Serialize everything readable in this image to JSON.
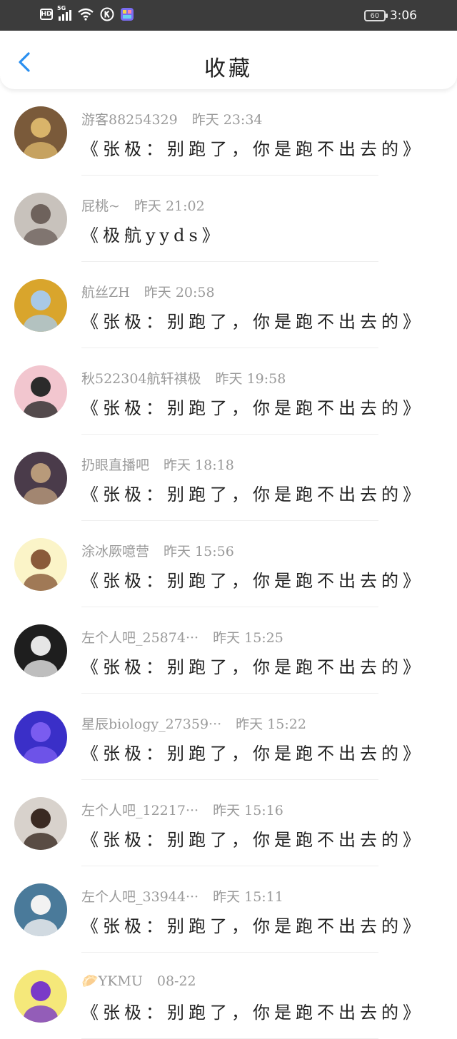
{
  "status_bar": {
    "hd": "HD",
    "network": "5G",
    "battery": "60",
    "time": "3:06"
  },
  "header": {
    "title": "收藏",
    "back_icon": "chevron-left-icon"
  },
  "colors": {
    "accent": "#2a8ff0",
    "status_bar_bg": "#3c3c3c",
    "meta_text": "#9a9a9a"
  },
  "items": [
    {
      "user": "游客88254329",
      "time": "昨天 23:34",
      "text": "《张极：别跑了，你是跑不出去的》",
      "avatar_color": "#7a5a3a",
      "avatar_accent": "#d9b46a"
    },
    {
      "user": "屁桃~",
      "time": "昨天 21:02",
      "text": "《极航yyds》",
      "avatar_color": "#c8c2bc",
      "avatar_accent": "#6e625c"
    },
    {
      "user": "航丝ZH",
      "time": "昨天 20:58",
      "text": "《张极：别跑了，你是跑不出去的》",
      "avatar_color": "#d9a52c",
      "avatar_accent": "#a9c9e6"
    },
    {
      "user": "秋522304航轩祺极",
      "time": "昨天 19:58",
      "text": "《张极：别跑了，你是跑不出去的》",
      "avatar_color": "#f2c6cf",
      "avatar_accent": "#2b2b2b"
    },
    {
      "user": "扔眼直播吧",
      "time": "昨天 18:18",
      "text": "《张极：别跑了，你是跑不出去的》",
      "avatar_color": "#4a3b4a",
      "avatar_accent": "#b89a7a"
    },
    {
      "user": "涂冰厥噫营",
      "time": "昨天 15:56",
      "text": "《张极：别跑了，你是跑不出去的》",
      "avatar_color": "#fbf4c8",
      "avatar_accent": "#8a5a3a"
    },
    {
      "user": "左个人吧_25874···",
      "time": "昨天 15:25",
      "text": "《张极：别跑了，你是跑不出去的》",
      "avatar_color": "#1e1e1e",
      "avatar_accent": "#e6e6e6"
    },
    {
      "user": "星辰biology_27359···",
      "time": "昨天 15:22",
      "text": "《张极：别跑了，你是跑不出去的》",
      "avatar_color": "#3a2fc8",
      "avatar_accent": "#7a5cf0"
    },
    {
      "user": "左个人吧_12217···",
      "time": "昨天 15:16",
      "text": "《张极：别跑了，你是跑不出去的》",
      "avatar_color": "#d8d2cc",
      "avatar_accent": "#3a2a22"
    },
    {
      "user": "左个人吧_33944···",
      "time": "昨天 15:11",
      "text": "《张极：别跑了，你是跑不出去的》",
      "avatar_color": "#4a7a9a",
      "avatar_accent": "#f2f2f2"
    },
    {
      "user": "🥟YKMU",
      "time": "08-22",
      "text": "《张极：别跑了，你是跑不出去的》",
      "avatar_color": "#f5e87a",
      "avatar_accent": "#7a3ac8"
    }
  ]
}
